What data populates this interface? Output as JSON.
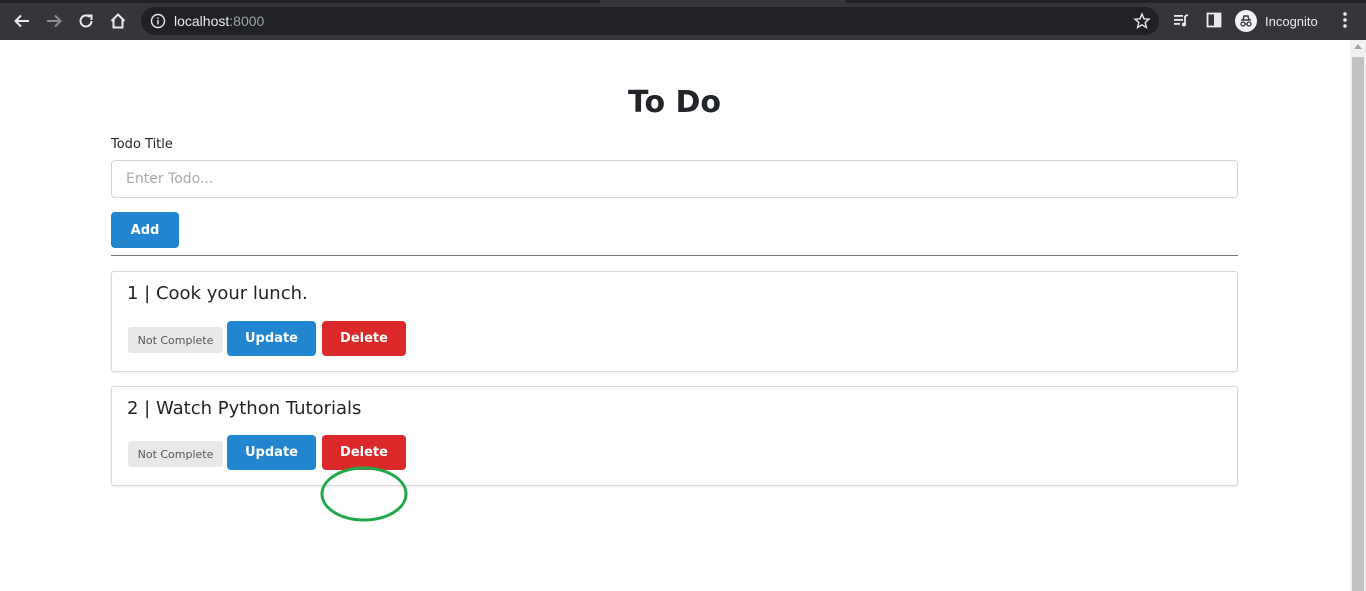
{
  "browser": {
    "url_host": "localhost",
    "url_port": ":8000",
    "profile_label": "Incognito",
    "icons": [
      "back-icon",
      "forward-icon",
      "reload-icon",
      "home-icon",
      "info-icon",
      "star-icon",
      "media-icon",
      "side-panel-icon",
      "incognito-icon",
      "menu-icon"
    ]
  },
  "page": {
    "title": "To Do",
    "field_label": "Todo Title",
    "input_placeholder": "Enter Todo...",
    "input_value": "",
    "add_label": "Add"
  },
  "todos": [
    {
      "title": "1 | Cook your lunch.",
      "status": "Not Complete",
      "update_label": "Update",
      "delete_label": "Delete"
    },
    {
      "title": "2 | Watch Python Tutorials",
      "status": "Not Complete",
      "update_label": "Update",
      "delete_label": "Delete"
    }
  ],
  "colors": {
    "primary": "#2185d0",
    "danger": "#db2828",
    "highlight": "#21a84a",
    "chrome_bg": "#35363a"
  }
}
